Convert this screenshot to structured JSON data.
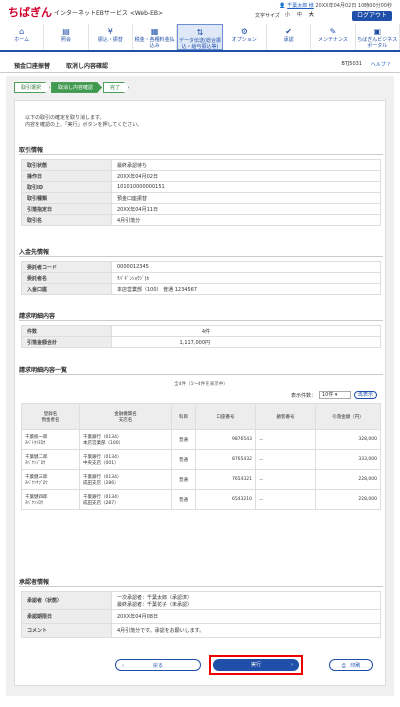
{
  "header": {
    "logo_mark": "ちばぎん",
    "logo_service": "インターネットEBサービス <Web-EB>",
    "user_name": "千葉太郎 様",
    "last_login": "20XX年04月02日 10時00分00秒",
    "font_size_label": "文字サイズ",
    "font_small": "小",
    "font_mid": "中",
    "font_big": "大",
    "logout": "ログアウト"
  },
  "nav": [
    {
      "icon": "home-icon",
      "glyph": "⌂",
      "label": "ホーム"
    },
    {
      "icon": "inquiry-icon",
      "glyph": "▤",
      "label": "照会"
    },
    {
      "icon": "transfer-icon",
      "glyph": "¥",
      "label": "振込・振替"
    },
    {
      "icon": "tax-icon",
      "glyph": "▦",
      "label": "税金・各種料金払込み"
    },
    {
      "icon": "data-icon",
      "glyph": "⇅",
      "label": "データ伝送(総合振込・給与振込等)"
    },
    {
      "icon": "option-icon",
      "glyph": "⚙",
      "label": "オプション"
    },
    {
      "icon": "approve-icon",
      "glyph": "✔",
      "label": "承認"
    },
    {
      "icon": "maintenance-icon",
      "glyph": "✎",
      "label": "メンテナンス"
    },
    {
      "icon": "business-icon",
      "glyph": "▣",
      "label": "ちばぎんビジネスポータル"
    }
  ],
  "subhead": {
    "title1": "預金口座振替",
    "title2": "取消し内容確認",
    "screen_id": "BTJ5031",
    "help": "ヘルプ ?"
  },
  "steps": [
    "取引選択",
    "取消し内容確認",
    "完了"
  ],
  "intro": [
    "以下の取引の確定を取り消します。",
    "内容を確認の上、「実行」ボタンを押してください。"
  ],
  "sections": {
    "trans": "取引情報",
    "requester": "入金先情報",
    "summary": "請求明細内容",
    "detail_list": "請求明細内容一覧",
    "approver": "承認者情報"
  },
  "trans_info": [
    {
      "k": "取引状態",
      "v": "最終承認待ち"
    },
    {
      "k": "操作日",
      "v": "20XX年04月02日"
    },
    {
      "k": "取引ID",
      "v": "101010000000151"
    },
    {
      "k": "取引種類",
      "v": "預金口座振替"
    },
    {
      "k": "引落指定日",
      "v": "20XX年04月11日"
    },
    {
      "k": "取引名",
      "v": "4月引落分"
    }
  ],
  "requester_info": [
    {
      "k": "委託者コード",
      "v": "0000012345"
    },
    {
      "k": "委託者名",
      "v": "ﾁﾊﾞｷﾞﾝｼｮｳｼﾞ(ｶ"
    },
    {
      "k": "入金口座",
      "v": "本店営業部（100） 普通 1234567"
    }
  ],
  "summary": [
    {
      "k": "件数",
      "v": "4件"
    },
    {
      "k": "引落金額合計",
      "v": "1,117,000円"
    }
  ],
  "list": {
    "count_text": "全4件（1～4件を表示中）",
    "per_page_label": "表示件数：",
    "per_page_value": "10件 ▾",
    "redisplay": "再表示",
    "headers": [
      "登録名\n預金者名",
      "金融機関名\n支店名",
      "科目",
      "口座番号",
      "顧客番号",
      "引落金額（円）"
    ],
    "rows": [
      {
        "reg": "千葉統一郎",
        "kana": "ﾁﾊﾞﾄｳｲﾁﾛｳ",
        "bank": "千葉銀行（0134）",
        "branch": "本店営業部（100）",
        "type": "普通",
        "acct": "9876543",
        "cust": "－",
        "amt": "328,000"
      },
      {
        "reg": "千葉健二郎",
        "kana": "ﾁﾊﾞｹﾝｼﾞﾛｳ",
        "bank": "千葉銀行（0134）",
        "branch": "中央支店（001）",
        "type": "普通",
        "acct": "8765432",
        "cust": "－",
        "amt": "333,000"
      },
      {
        "reg": "千葉健三郎",
        "kana": "ﾁﾊﾞｹﾝｻﾌﾞﾛｳ",
        "bank": "千葉銀行（0134）",
        "branch": "成田支店（286）",
        "type": "普通",
        "acct": "7654321",
        "cust": "－",
        "amt": "228,000"
      },
      {
        "reg": "千葉健四郎",
        "kana": "ﾁﾊﾞｹﾝｼﾛｳ",
        "bank": "千葉銀行（0134）",
        "branch": "成田支店（287）",
        "type": "普通",
        "acct": "6543210",
        "cust": "－",
        "amt": "228,000"
      }
    ]
  },
  "approver_info": [
    {
      "k": "承認者（状態）",
      "v": "一次承認者：千葉太郎（承認済）",
      "v2": "最終承認者：千葉花子（未承認）"
    },
    {
      "k": "承認期限日",
      "v": "20XX年04月08日",
      "v2": ""
    },
    {
      "k": "コメント",
      "v": "4月引落分です。承認をお願いします。",
      "v2": ""
    }
  ],
  "buttons": {
    "back": "戻る",
    "execute": "実行",
    "print": "印刷"
  },
  "colors": {
    "brand_red": "#d0002b",
    "brand_blue": "#1f4fa8",
    "step_green": "#3f9a4f",
    "highlight": "#ee0000"
  }
}
